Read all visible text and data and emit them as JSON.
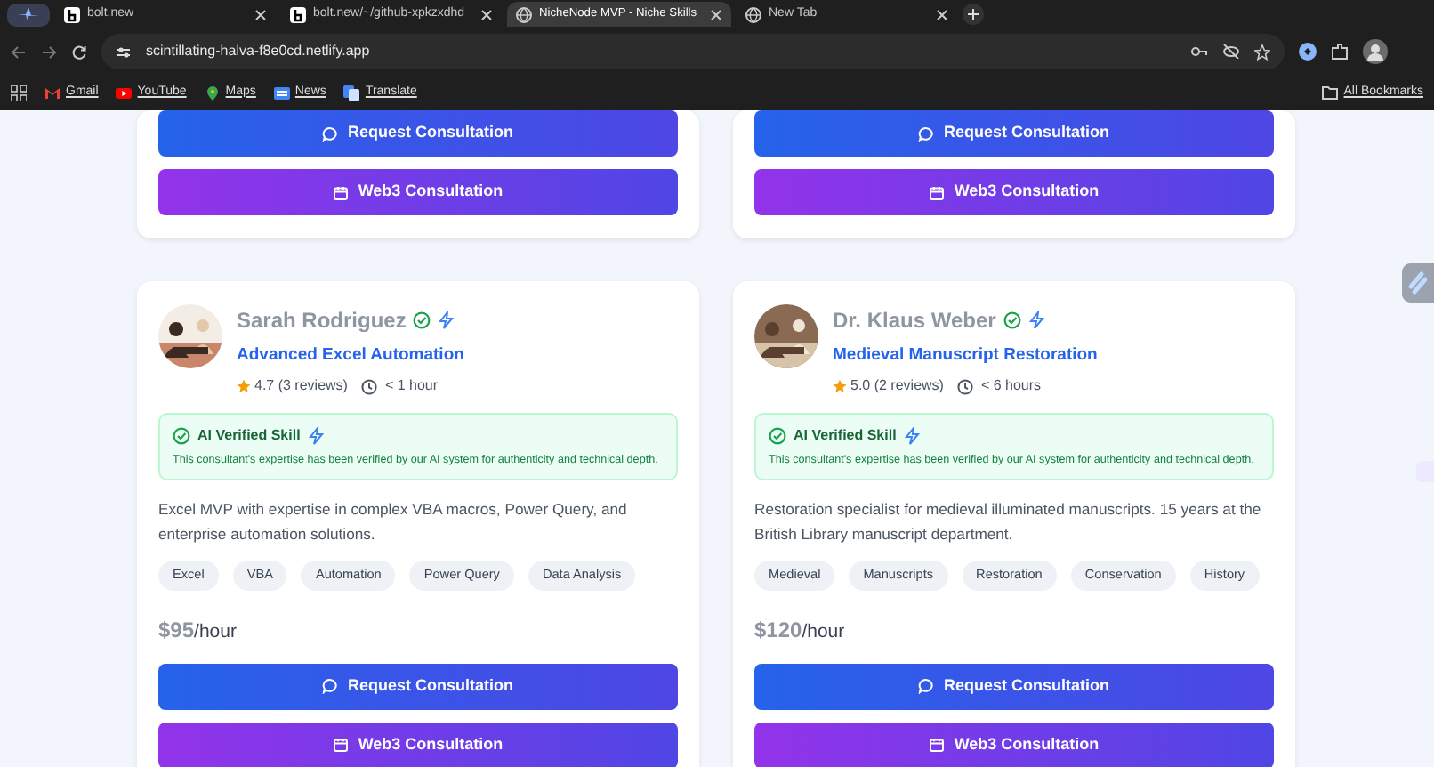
{
  "browser": {
    "tabs": [
      {
        "title": "bolt.new",
        "selected": false
      },
      {
        "title": "bolt.new/~/github-xpkzxdhd",
        "selected": false
      },
      {
        "title": "NicheNode MVP - Niche Skills",
        "selected": true
      },
      {
        "title": "New Tab",
        "selected": false
      }
    ],
    "address": "scintillating-halva-f8e0cd.netlify.app",
    "bookmarks": [
      {
        "label": "Gmail"
      },
      {
        "label": "YouTube"
      },
      {
        "label": "Maps"
      },
      {
        "label": "News"
      },
      {
        "label": "Translate"
      }
    ],
    "all_bookmarks": "All Bookmarks"
  },
  "top_cards": [
    {
      "request_button": "Request Consultation",
      "web3_button": "Web3 Consultation"
    },
    {
      "request_button": "Request Consultation",
      "web3_button": "Web3 Consultation"
    }
  ],
  "consultants": [
    {
      "name": "Sarah Rodriguez",
      "skill": "Advanced Excel Automation",
      "rating": "4.7",
      "reviews": "(3 reviews)",
      "response": "< 1 hour",
      "verified_title": "AI Verified Skill",
      "verified_text": "This consultant's expertise has been verified by our AI system for authenticity and technical depth.",
      "description": "Excel MVP with expertise in complex VBA macros, Power Query, and enterprise automation solutions.",
      "tags": [
        "Excel",
        "VBA",
        "Automation",
        "Power Query",
        "Data Analysis"
      ],
      "price": "$95",
      "unit": "/hour",
      "request_button": "Request Consultation",
      "web3_button": "Web3 Consultation"
    },
    {
      "name": "Dr. Klaus Weber",
      "skill": "Medieval Manuscript Restoration",
      "rating": "5.0",
      "reviews": "(2 reviews)",
      "response": "< 6 hours",
      "verified_title": "AI Verified Skill",
      "verified_text": "This consultant's expertise has been verified by our AI system for authenticity and technical depth.",
      "description": "Restoration specialist for medieval illuminated manuscripts. 15 years at the British Library manuscript department.",
      "tags": [
        "Medieval",
        "Manuscripts",
        "Restoration",
        "Conservation",
        "History"
      ],
      "price": "$120",
      "unit": "/hour",
      "request_button": "Request Consultation",
      "web3_button": "Web3 Consultation"
    }
  ]
}
